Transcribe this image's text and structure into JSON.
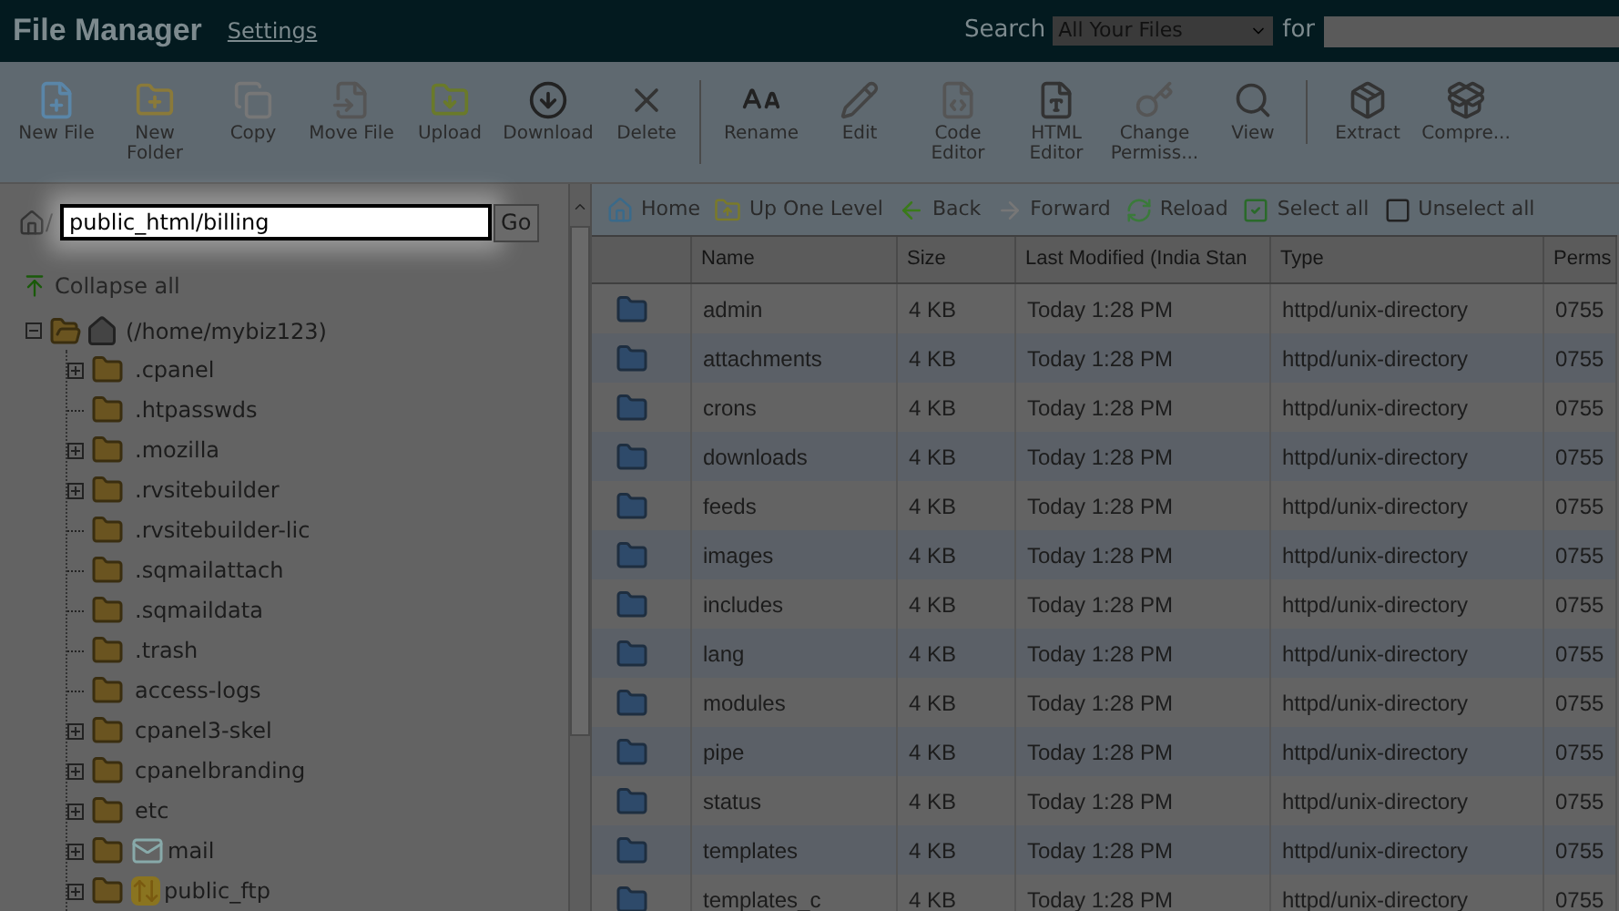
{
  "header": {
    "title": "File Manager",
    "settings_link": "Settings",
    "search_label": "Search",
    "search_scope": "All Your Files",
    "for_label": "for"
  },
  "toolbar": [
    [
      {
        "label": "New File"
      },
      {
        "label": "New Folder"
      },
      {
        "label": "Copy"
      },
      {
        "label": "Move File"
      },
      {
        "label": "Upload"
      },
      {
        "label": "Download"
      },
      {
        "label": "Delete"
      }
    ],
    [
      {
        "label": "Rename"
      },
      {
        "label": "Edit"
      },
      {
        "label": "Code Editor"
      },
      {
        "label": "HTML Editor"
      },
      {
        "label": "Change Permiss..."
      },
      {
        "label": "View"
      }
    ],
    [
      {
        "label": "Extract"
      },
      {
        "label": "Compre..."
      }
    ]
  ],
  "path_bar": {
    "separator": "/",
    "value": "public_html/billing",
    "go": "Go"
  },
  "tree": {
    "collapse_all": "Collapse all",
    "root": {
      "label": "(/home/mybiz123)",
      "expanded": true,
      "children": [
        {
          "label": ".cpanel",
          "kind": "folder",
          "expandable": true
        },
        {
          "label": ".htpasswds",
          "kind": "folder",
          "expandable": false
        },
        {
          "label": ".mozilla",
          "kind": "folder",
          "expandable": true
        },
        {
          "label": ".rvsitebuilder",
          "kind": "folder",
          "expandable": true
        },
        {
          "label": ".rvsitebuilder-lic",
          "kind": "folder",
          "expandable": false
        },
        {
          "label": ".sqmailattach",
          "kind": "folder",
          "expandable": false
        },
        {
          "label": ".sqmaildata",
          "kind": "folder",
          "expandable": false
        },
        {
          "label": ".trash",
          "kind": "folder",
          "expandable": false
        },
        {
          "label": "access-logs",
          "kind": "folder",
          "expandable": false
        },
        {
          "label": "cpanel3-skel",
          "kind": "folder",
          "expandable": true
        },
        {
          "label": "cpanelbranding",
          "kind": "folder",
          "expandable": true
        },
        {
          "label": "etc",
          "kind": "folder",
          "expandable": true
        },
        {
          "label": "mail",
          "kind": "mail",
          "expandable": true
        },
        {
          "label": "public_ftp",
          "kind": "ftp",
          "expandable": true
        }
      ]
    }
  },
  "nav": [
    {
      "label": "Home"
    },
    {
      "label": "Up One Level"
    },
    {
      "label": "Back"
    },
    {
      "label": "Forward"
    },
    {
      "label": "Reload"
    },
    {
      "label": "Select all"
    },
    {
      "label": "Unselect all"
    }
  ],
  "table": {
    "columns": [
      "Name",
      "Size",
      "Last Modified (India Stan",
      "Type",
      "Perms"
    ],
    "rows": [
      [
        "admin",
        "4 KB",
        "Today 1:28 PM",
        "httpd/unix-directory",
        "0755"
      ],
      [
        "attachments",
        "4 KB",
        "Today 1:28 PM",
        "httpd/unix-directory",
        "0755"
      ],
      [
        "crons",
        "4 KB",
        "Today 1:28 PM",
        "httpd/unix-directory",
        "0755"
      ],
      [
        "downloads",
        "4 KB",
        "Today 1:28 PM",
        "httpd/unix-directory",
        "0755"
      ],
      [
        "feeds",
        "4 KB",
        "Today 1:28 PM",
        "httpd/unix-directory",
        "0755"
      ],
      [
        "images",
        "4 KB",
        "Today 1:28 PM",
        "httpd/unix-directory",
        "0755"
      ],
      [
        "includes",
        "4 KB",
        "Today 1:28 PM",
        "httpd/unix-directory",
        "0755"
      ],
      [
        "lang",
        "4 KB",
        "Today 1:28 PM",
        "httpd/unix-directory",
        "0755"
      ],
      [
        "modules",
        "4 KB",
        "Today 1:28 PM",
        "httpd/unix-directory",
        "0755"
      ],
      [
        "pipe",
        "4 KB",
        "Today 1:28 PM",
        "httpd/unix-directory",
        "0755"
      ],
      [
        "status",
        "4 KB",
        "Today 1:28 PM",
        "httpd/unix-directory",
        "0755"
      ],
      [
        "templates",
        "4 KB",
        "Today 1:28 PM",
        "httpd/unix-directory",
        "0755"
      ],
      [
        "templates_c",
        "4 KB",
        "Today 1:28 PM",
        "httpd/unix-directory",
        "0755"
      ]
    ]
  }
}
